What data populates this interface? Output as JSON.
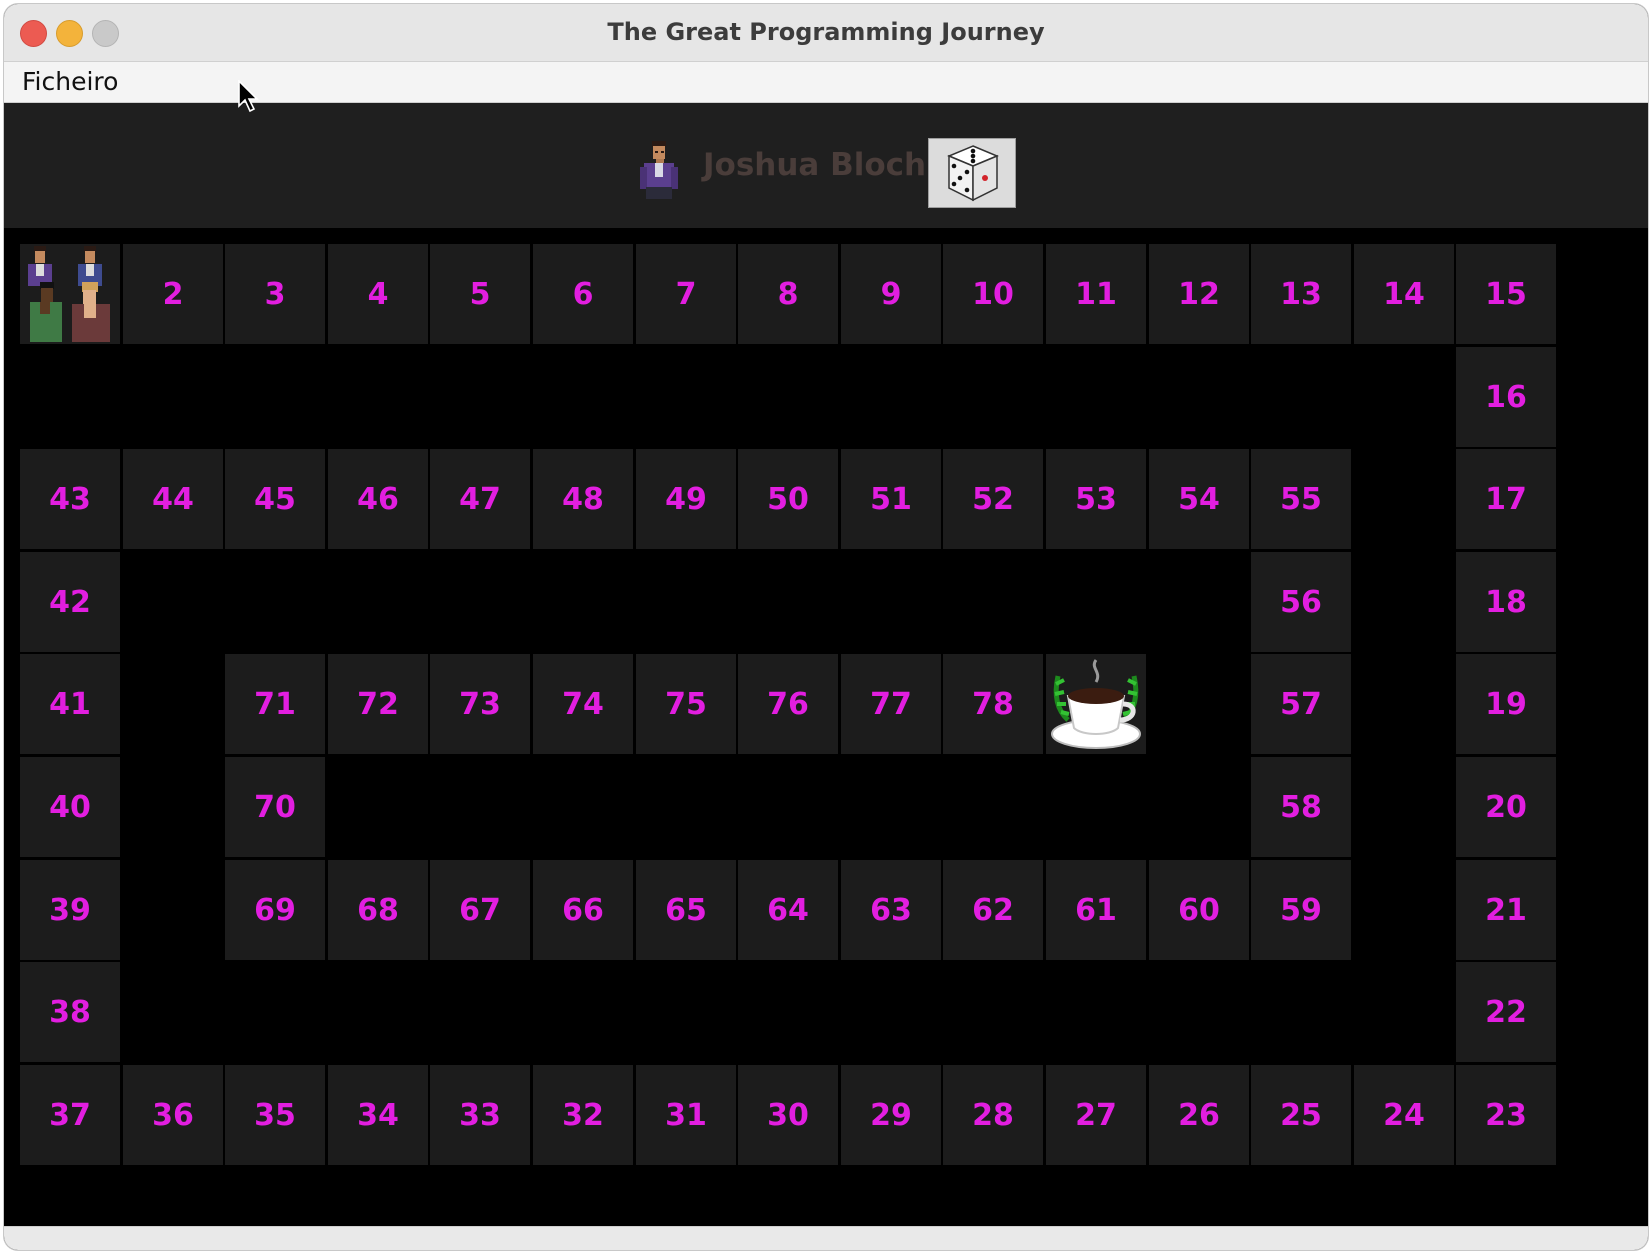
{
  "window": {
    "title": "The Great Programming Journey"
  },
  "menu": {
    "file_label": "Ficheiro"
  },
  "current_player": {
    "name": "Joshua Bloch"
  },
  "colors": {
    "cell_number": "#e21ee0",
    "cell_bg": "#1c1c1c",
    "board_bg": "#000000",
    "player_name": "#4a3d3a"
  },
  "board": {
    "start_cell": 1,
    "finish_cell": 79,
    "finish_icon": "coffee-cup-icon",
    "start_icon": "player-group-icon",
    "dice_face": 5,
    "cells": [
      {
        "n": 1,
        "label": ""
      },
      {
        "n": 2,
        "label": "2"
      },
      {
        "n": 3,
        "label": "3"
      },
      {
        "n": 4,
        "label": "4"
      },
      {
        "n": 5,
        "label": "5"
      },
      {
        "n": 6,
        "label": "6"
      },
      {
        "n": 7,
        "label": "7"
      },
      {
        "n": 8,
        "label": "8"
      },
      {
        "n": 9,
        "label": "9"
      },
      {
        "n": 10,
        "label": "10"
      },
      {
        "n": 11,
        "label": "11"
      },
      {
        "n": 12,
        "label": "12"
      },
      {
        "n": 13,
        "label": "13"
      },
      {
        "n": 14,
        "label": "14"
      },
      {
        "n": 15,
        "label": "15"
      },
      {
        "n": 16,
        "label": "16"
      },
      {
        "n": 17,
        "label": "17"
      },
      {
        "n": 18,
        "label": "18"
      },
      {
        "n": 19,
        "label": "19"
      },
      {
        "n": 20,
        "label": "20"
      },
      {
        "n": 21,
        "label": "21"
      },
      {
        "n": 22,
        "label": "22"
      },
      {
        "n": 23,
        "label": "23"
      },
      {
        "n": 24,
        "label": "24"
      },
      {
        "n": 25,
        "label": "25"
      },
      {
        "n": 26,
        "label": "26"
      },
      {
        "n": 27,
        "label": "27"
      },
      {
        "n": 28,
        "label": "28"
      },
      {
        "n": 29,
        "label": "29"
      },
      {
        "n": 30,
        "label": "30"
      },
      {
        "n": 31,
        "label": "31"
      },
      {
        "n": 32,
        "label": "32"
      },
      {
        "n": 33,
        "label": "33"
      },
      {
        "n": 34,
        "label": "34"
      },
      {
        "n": 35,
        "label": "35"
      },
      {
        "n": 36,
        "label": "36"
      },
      {
        "n": 37,
        "label": "37"
      },
      {
        "n": 38,
        "label": "38"
      },
      {
        "n": 39,
        "label": "39"
      },
      {
        "n": 40,
        "label": "40"
      },
      {
        "n": 41,
        "label": "41"
      },
      {
        "n": 42,
        "label": "42"
      },
      {
        "n": 43,
        "label": "43"
      },
      {
        "n": 44,
        "label": "44"
      },
      {
        "n": 45,
        "label": "45"
      },
      {
        "n": 46,
        "label": "46"
      },
      {
        "n": 47,
        "label": "47"
      },
      {
        "n": 48,
        "label": "48"
      },
      {
        "n": 49,
        "label": "49"
      },
      {
        "n": 50,
        "label": "50"
      },
      {
        "n": 51,
        "label": "51"
      },
      {
        "n": 52,
        "label": "52"
      },
      {
        "n": 53,
        "label": "53"
      },
      {
        "n": 54,
        "label": "54"
      },
      {
        "n": 55,
        "label": "55"
      },
      {
        "n": 56,
        "label": "56"
      },
      {
        "n": 57,
        "label": "57"
      },
      {
        "n": 58,
        "label": "58"
      },
      {
        "n": 59,
        "label": "59"
      },
      {
        "n": 60,
        "label": "60"
      },
      {
        "n": 61,
        "label": "61"
      },
      {
        "n": 62,
        "label": "62"
      },
      {
        "n": 63,
        "label": "63"
      },
      {
        "n": 64,
        "label": "64"
      },
      {
        "n": 65,
        "label": "65"
      },
      {
        "n": 66,
        "label": "66"
      },
      {
        "n": 67,
        "label": "67"
      },
      {
        "n": 68,
        "label": "68"
      },
      {
        "n": 69,
        "label": "69"
      },
      {
        "n": 70,
        "label": "70"
      },
      {
        "n": 71,
        "label": "71"
      },
      {
        "n": 72,
        "label": "72"
      },
      {
        "n": 73,
        "label": "73"
      },
      {
        "n": 74,
        "label": "74"
      },
      {
        "n": 75,
        "label": "75"
      },
      {
        "n": 76,
        "label": "76"
      },
      {
        "n": 77,
        "label": "77"
      },
      {
        "n": 78,
        "label": "78"
      },
      {
        "n": 79,
        "label": ""
      }
    ]
  }
}
